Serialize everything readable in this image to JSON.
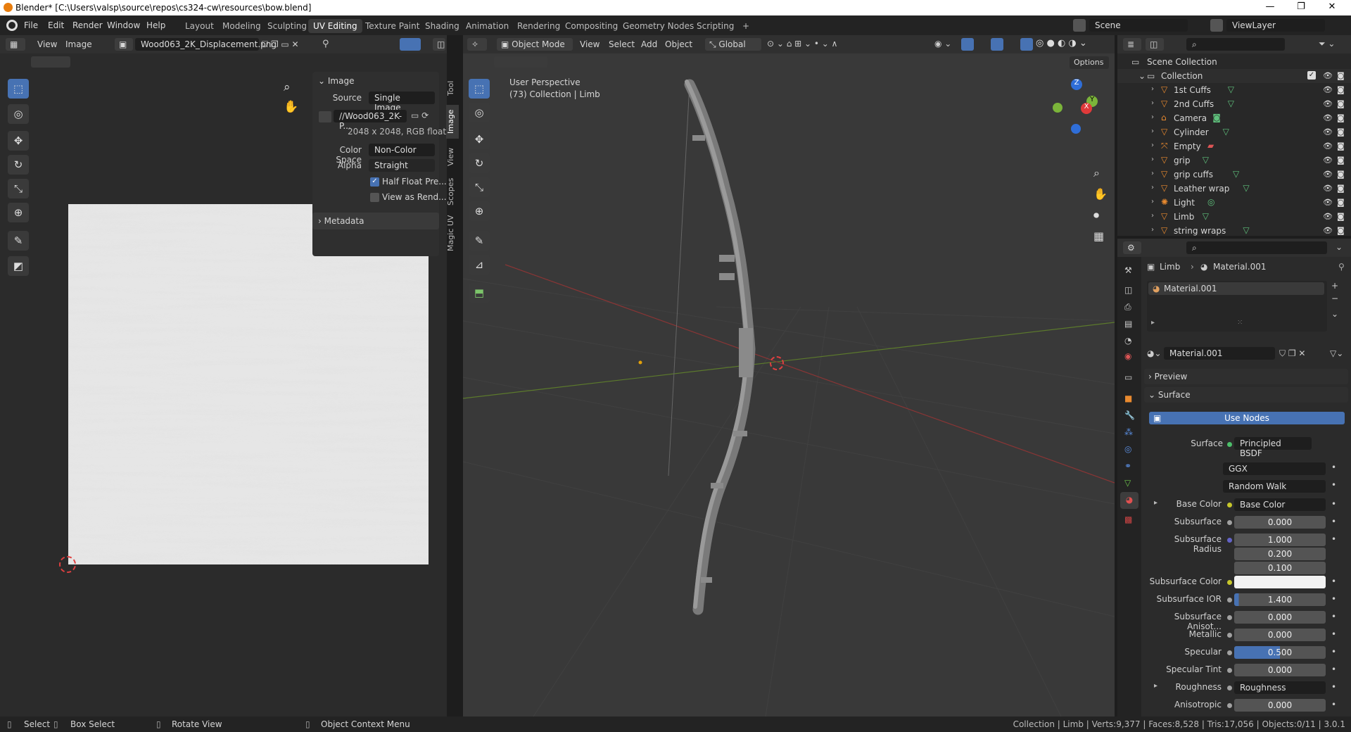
{
  "window": {
    "title": "Blender* [C:\\Users\\valsp\\source\\repos\\cs324-cw\\resources\\bow.blend]",
    "minimize": "—",
    "maximize": "❐",
    "close": "✕"
  },
  "menu": [
    "File",
    "Edit",
    "Render",
    "Window",
    "Help"
  ],
  "workspaces": {
    "tabs": [
      "Layout",
      "Modeling",
      "Sculpting",
      "UV Editing",
      "Texture Paint",
      "Shading",
      "Animation",
      "Rendering",
      "Compositing",
      "Geometry Nodes",
      "Scripting"
    ],
    "active": "UV Editing",
    "add": "+"
  },
  "scene": {
    "name": "Scene",
    "view_layer": "ViewLayer"
  },
  "uv_editor": {
    "menu": [
      "View",
      "Image"
    ],
    "image_name": "Wood063_2K_Displacement.png",
    "n_panel": {
      "image_header": "Image",
      "source_label": "Source",
      "source_value": "Single Image",
      "filepath": "//Wood063_2K-P...",
      "dimensions": "2048 x 2048,  RGB float",
      "color_space_label": "Color Space",
      "color_space_value": "Non-Color",
      "alpha_label": "Alpha",
      "alpha_value": "Straight",
      "half_float": "Half Float Pre...",
      "half_float_checked": true,
      "view_as_render": "View as Rend...",
      "metadata_header": "Metadata"
    },
    "side_tabs": [
      "Tool",
      "Image",
      "View",
      "Scopes",
      "Magic UV"
    ]
  },
  "viewport": {
    "mode": "Object Mode",
    "menu": [
      "View",
      "Select",
      "Add",
      "Object"
    ],
    "orientation": "Global",
    "options": "Options",
    "overlay_title": "User Perspective",
    "overlay_sub": "(73) Collection | Limb",
    "gizmo": {
      "x": "X",
      "y": "Y",
      "z": "Z"
    }
  },
  "outliner": {
    "root": "Scene Collection",
    "collection": "Collection",
    "items": [
      {
        "name": "1st Cuffs",
        "type": "mesh"
      },
      {
        "name": "2nd Cuffs",
        "type": "mesh"
      },
      {
        "name": "Camera",
        "type": "camera"
      },
      {
        "name": "Cylinder",
        "type": "mesh"
      },
      {
        "name": "Empty",
        "type": "empty"
      },
      {
        "name": "grip",
        "type": "mesh"
      },
      {
        "name": "grip cuffs",
        "type": "mesh"
      },
      {
        "name": "Leather wrap",
        "type": "mesh"
      },
      {
        "name": "Light",
        "type": "light"
      },
      {
        "name": "Limb",
        "type": "mesh"
      },
      {
        "name": "string wraps",
        "type": "mesh"
      }
    ]
  },
  "properties": {
    "breadcrumb_object": "Limb",
    "breadcrumb_material": "Material.001",
    "slot": "Material.001",
    "material_name": "Material.001",
    "preview": "Preview",
    "surface_section": "Surface",
    "use_nodes": "Use Nodes",
    "surface_label": "Surface",
    "surface_value": "Principled BSDF",
    "distribution": "GGX",
    "subsurface_method": "Random Walk",
    "rows": [
      {
        "label": "Base Color",
        "value": "Base Color",
        "kind": "link",
        "dot": "#c7c72b"
      },
      {
        "label": "Subsurface",
        "value": "0.000",
        "kind": "num",
        "dot": "#a1a1a1"
      },
      {
        "label": "Subsurface Radius",
        "value": "1.000",
        "kind": "num",
        "dot": "#6363c7"
      },
      {
        "label": "",
        "value": "0.200",
        "kind": "num",
        "dot": ""
      },
      {
        "label": "",
        "value": "0.100",
        "kind": "num",
        "dot": ""
      },
      {
        "label": "Subsurface Color",
        "value": "",
        "kind": "color",
        "dot": "#c7c72b"
      },
      {
        "label": "Subsurface IOR",
        "value": "1.400",
        "kind": "num",
        "dot": "#a1a1a1",
        "fill": 0.05
      },
      {
        "label": "Subsurface Anisot...",
        "value": "0.000",
        "kind": "num",
        "dot": "#a1a1a1"
      },
      {
        "label": "Metallic",
        "value": "0.000",
        "kind": "num",
        "dot": "#a1a1a1"
      },
      {
        "label": "Specular",
        "value": "0.500",
        "kind": "num",
        "dot": "#a1a1a1",
        "fill": 0.5
      },
      {
        "label": "Specular Tint",
        "value": "0.000",
        "kind": "num",
        "dot": "#a1a1a1"
      },
      {
        "label": "Roughness",
        "value": "Roughness",
        "kind": "link",
        "dot": "#a1a1a1"
      },
      {
        "label": "Anisotropic",
        "value": "0.000",
        "kind": "num",
        "dot": "#a1a1a1"
      }
    ]
  },
  "statusbar": {
    "select": "Select",
    "box_select": "Box Select",
    "rotate": "Rotate View",
    "context": "Object Context Menu",
    "stats": "Collection | Limb | Verts:9,377 | Faces:8,528 | Tris:17,056 | Objects:0/11 | 3.0.1"
  }
}
